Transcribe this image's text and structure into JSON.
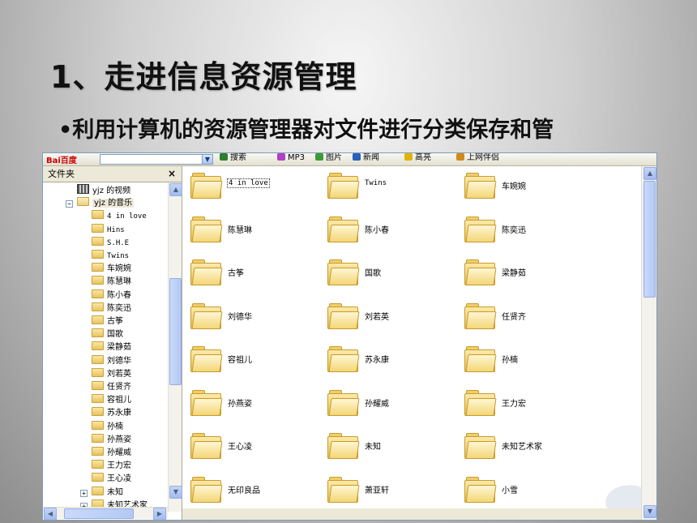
{
  "slide": {
    "title": "1、走进信息资源管理",
    "bullet": "•利用计算机的资源管理器对文件进行分类保存和管"
  },
  "toolbar": {
    "baidu_logo": "Bai百度",
    "buttons": [
      {
        "label": "搜索",
        "icon": "search-icon",
        "color": "#2f7d2f"
      },
      {
        "label": "MP3",
        "icon": "music-icon",
        "color": "#b041c4"
      },
      {
        "label": "图片",
        "icon": "image-icon",
        "color": "#3a9a3a"
      },
      {
        "label": "新闻",
        "icon": "news-icon",
        "color": "#2a60b8"
      },
      {
        "label": "高亮",
        "icon": "highlight-icon",
        "color": "#e0b400"
      },
      {
        "label": "上网伴侣",
        "icon": "companion-icon",
        "color": "#d08a1c"
      }
    ]
  },
  "folder_pane": {
    "title": "文件夹",
    "close": "×",
    "tree": [
      {
        "label": "yjz 的视频",
        "icon": "video-folder-icon",
        "level": 1,
        "expander": ""
      },
      {
        "label": "yjz 的音乐",
        "icon": "music-folder-icon",
        "level": 1,
        "expander": "−",
        "selected": true
      },
      {
        "label": "4 in love",
        "level": 2,
        "mono": true
      },
      {
        "label": "Hins",
        "level": 2,
        "mono": true
      },
      {
        "label": "S.H.E",
        "level": 2,
        "mono": true
      },
      {
        "label": "Twins",
        "level": 2,
        "mono": true
      },
      {
        "label": "车婉婉",
        "level": 2
      },
      {
        "label": "陈慧琳",
        "level": 2
      },
      {
        "label": "陈小春",
        "level": 2
      },
      {
        "label": "陈奕迅",
        "level": 2
      },
      {
        "label": "古筝",
        "level": 2
      },
      {
        "label": "国歌",
        "level": 2
      },
      {
        "label": "梁静茹",
        "level": 2
      },
      {
        "label": "刘德华",
        "level": 2
      },
      {
        "label": "刘若英",
        "level": 2
      },
      {
        "label": "任贤齐",
        "level": 2
      },
      {
        "label": "容祖儿",
        "level": 2
      },
      {
        "label": "苏永康",
        "level": 2
      },
      {
        "label": "孙楠",
        "level": 2
      },
      {
        "label": "孙燕姿",
        "level": 2
      },
      {
        "label": "孙耀威",
        "level": 2
      },
      {
        "label": "王力宏",
        "level": 2
      },
      {
        "label": "王心凌",
        "level": 2
      },
      {
        "label": "未知",
        "level": 2,
        "expander": "+"
      },
      {
        "label": "未知艺术家",
        "level": 2,
        "expander": "+"
      }
    ]
  },
  "content": {
    "folders": [
      {
        "label": "4 in love",
        "mono": true,
        "focus": true
      },
      {
        "label": "Twins",
        "mono": true
      },
      {
        "label": "车婉婉"
      },
      {
        "label": "陈慧琳"
      },
      {
        "label": "陈小春"
      },
      {
        "label": "陈奕迅"
      },
      {
        "label": "古筝"
      },
      {
        "label": "国歌"
      },
      {
        "label": "梁静茹"
      },
      {
        "label": "刘德华"
      },
      {
        "label": "刘若英"
      },
      {
        "label": "任贤齐"
      },
      {
        "label": "容祖儿"
      },
      {
        "label": "苏永康"
      },
      {
        "label": "孙楠"
      },
      {
        "label": "孙燕姿"
      },
      {
        "label": "孙耀威"
      },
      {
        "label": "王力宏"
      },
      {
        "label": "王心凌"
      },
      {
        "label": "未知"
      },
      {
        "label": "未知艺术家"
      },
      {
        "label": "无印良品"
      },
      {
        "label": "萧亚轩"
      },
      {
        "label": "小雪"
      }
    ]
  },
  "colors": {
    "window_border": "#7f9db9",
    "folder_fill": "#f3d676",
    "chrome": "#ece9d8"
  }
}
